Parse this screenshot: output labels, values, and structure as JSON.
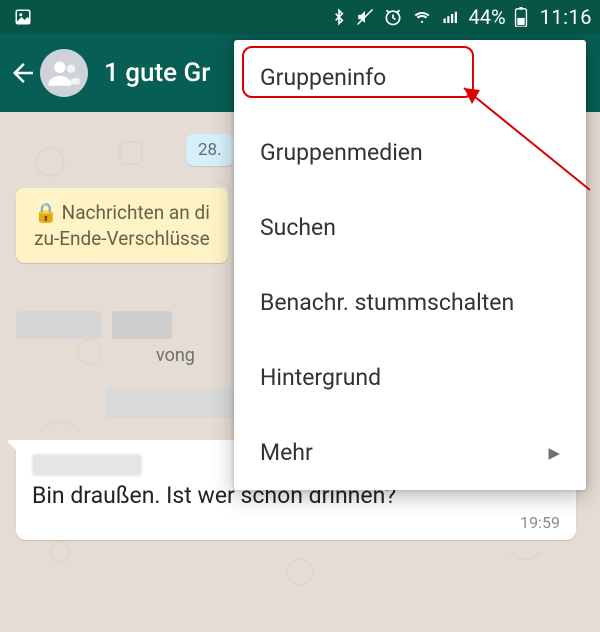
{
  "statusbar": {
    "battery_pct": "44%",
    "clock": "11:16"
  },
  "header": {
    "title": "1 gute Gr",
    "subtitle": ""
  },
  "chat": {
    "date_chip": "28.",
    "encryption_partial": "Nachrichten an di\nzu-Ende-Verschlüsse",
    "vong_text": "vong",
    "bubble1": {
      "text": "Bin draußen. Ist wer schon drinnen?",
      "time": "19:59"
    }
  },
  "menu": {
    "items": [
      "Gruppeninfo",
      "Gruppenmedien",
      "Suchen",
      "Benachr. stummschalten",
      "Hintergrund",
      "Mehr"
    ]
  }
}
